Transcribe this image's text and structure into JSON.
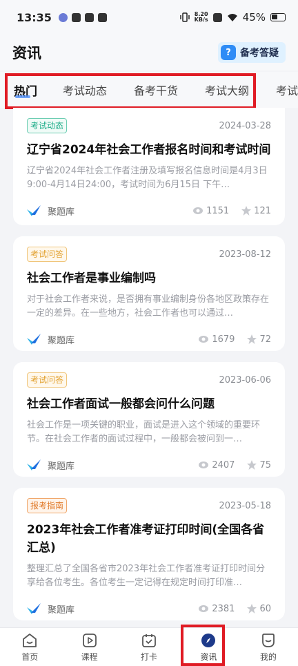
{
  "status_bar": {
    "time": "13:35",
    "net_speed": "8.20",
    "net_unit": "KB/s",
    "battery": "45%"
  },
  "header": {
    "title": "资讯",
    "qa_button": "备考答疑"
  },
  "tabs": [
    {
      "label": "热门",
      "active": true
    },
    {
      "label": "考试动态",
      "active": false
    },
    {
      "label": "备考干货",
      "active": false
    },
    {
      "label": "考试大纲",
      "active": false
    },
    {
      "label": "考试",
      "active": false
    }
  ],
  "articles": [
    {
      "tag": "考试动态",
      "tag_color": "#1fae8a",
      "date": "2024-03-28",
      "title": "辽宁省2024年社会工作者报名时间和考试时间",
      "desc": "辽宁省2024年社会工作者注册及填写报名信息时间是4月3日9:00-4月14日24:00，考试时间为6月15日 下午…",
      "source": "聚题库",
      "views": "1151",
      "stars": "121"
    },
    {
      "tag": "考试问答",
      "tag_color": "#e2a02e",
      "date": "2023-08-12",
      "title": "社会工作者是事业编制吗",
      "desc": "对于社会工作者来说，是否拥有事业编制身份各地区政策存在一定的差异。在一些地方，社会工作者也可以通过…",
      "source": "聚题库",
      "views": "1679",
      "stars": "72"
    },
    {
      "tag": "考试问答",
      "tag_color": "#e2a02e",
      "date": "2023-06-06",
      "title": "社会工作者面试一般都会问什么问题",
      "desc": "社会工作是一项关键的职业，面试是进入这个领域的重要环节。在社会工作者的面试过程中，一般都会被问到一…",
      "source": "聚题库",
      "views": "2407",
      "stars": "75"
    },
    {
      "tag": "报考指南",
      "tag_color": "#e07a2a",
      "date": "2023-05-18",
      "title": "2023年社会工作者准考证打印时间(全国各省汇总)",
      "desc": "整理汇总了全国各省市2023年社会工作者准考证打印时间分享给各位考生。各位考生一定记得在规定时间打印准…",
      "source": "聚题库",
      "views": "2381",
      "stars": "60"
    }
  ],
  "bottom_nav": [
    {
      "label": "首页",
      "icon": "home-icon"
    },
    {
      "label": "课程",
      "icon": "play-icon"
    },
    {
      "label": "打卡",
      "icon": "calendar-check-icon"
    },
    {
      "label": "资讯",
      "icon": "compass-icon",
      "active": true
    },
    {
      "label": "我的",
      "icon": "profile-icon"
    }
  ]
}
